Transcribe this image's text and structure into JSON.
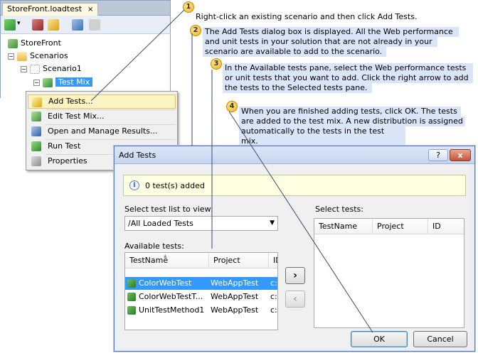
{
  "editor": {
    "tab_label": "StoreFront.loadtest",
    "tab_close": "×",
    "toolbar_dropdown": "▾"
  },
  "tree": {
    "root": "StoreFront",
    "scenarios": "Scenarios",
    "scenario1": "Scenario1",
    "test_mix": "Test Mix",
    "expand_glyph": "−"
  },
  "context_menu": {
    "items": [
      {
        "label": "Add Tests...",
        "icon": "add-tests-icon"
      },
      {
        "label": "Edit Test Mix...",
        "icon": "edit-mix-icon"
      },
      {
        "label": "Open and Manage Results...",
        "icon": "results-icon"
      },
      {
        "label": "Run Test",
        "icon": "run-test-icon"
      },
      {
        "label": "Properties",
        "icon": "properties-icon"
      }
    ]
  },
  "callouts": [
    {
      "num": "1",
      "text": "Right-click an existing scenario and then click Add Tests."
    },
    {
      "num": "2",
      "lines": [
        "The Add Tests dialog box is displayed. All the Web performance",
        "and unit tests in your solution that are not already in your",
        "scenario are available to add to the scenario."
      ]
    },
    {
      "num": "3",
      "lines": [
        "In the Available tests pane, select the Web performance tests",
        "or unit tests that you want to add. Click the right arrow to add",
        "the tests to the Selected tests pane."
      ]
    },
    {
      "num": "4",
      "lines": [
        "When you are finished adding tests, click OK. The tests",
        "are added to the test mix. A new distribution is assigned",
        "automatically to the tests in the test mix."
      ]
    }
  ],
  "dialog": {
    "title": "Add Tests",
    "help_glyph": "?",
    "close_glyph": "x",
    "info_glyph": "i",
    "info_text": "0 test(s) added",
    "select_list_label": "Select test list to view:",
    "select_list_value": "/All Loaded Tests",
    "combo_arrow": "▼",
    "available_label": "Available tests:",
    "select_tests_label": "Select tests:",
    "available_columns": [
      "TestName",
      "Project",
      "ID"
    ],
    "available_rows": [
      {
        "name": "ColorWebTest",
        "project": "WebAppTest",
        "id": "c:",
        "selected": true
      },
      {
        "name": "ColorWebTestT...",
        "project": "WebAppTest",
        "id": "c:",
        "selected": false
      },
      {
        "name": "UnitTestMethod1",
        "project": "WebAppTest",
        "id": "c:",
        "selected": false
      }
    ],
    "selected_columns": [
      "TestName",
      "Project",
      "ID"
    ],
    "add_arrow": "›",
    "remove_arrow": "‹",
    "ok_label": "OK",
    "cancel_label": "Cancel",
    "sort_glyph": "▲"
  },
  "colors": {
    "accent": "#3399ff",
    "callout_fill": "#f2b21a",
    "callout_text_bg": "#dbe5f8",
    "title_bar": "#c7d6f0"
  }
}
